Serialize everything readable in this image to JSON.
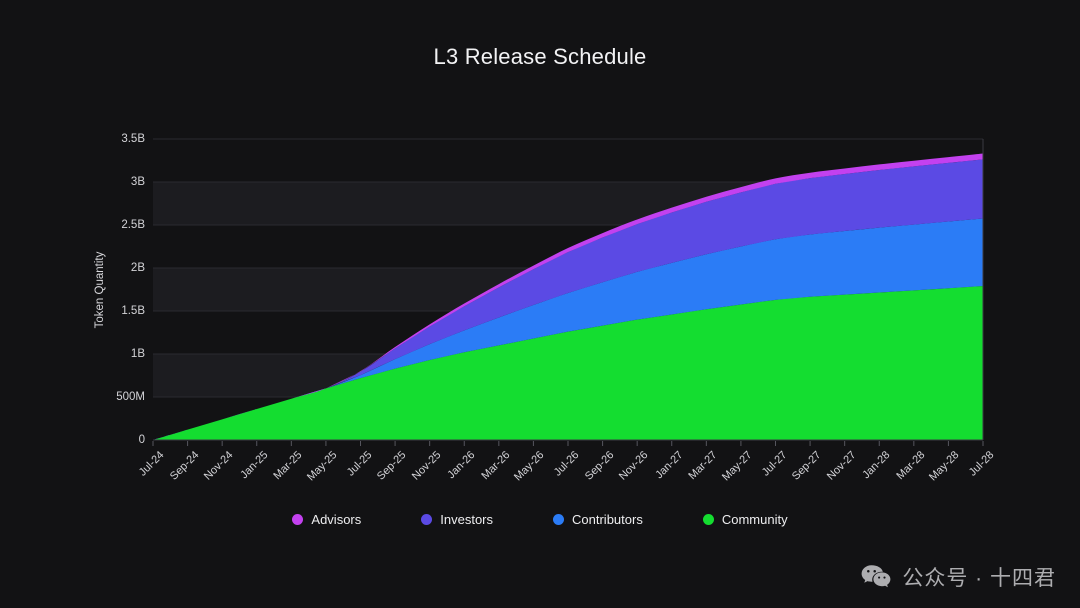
{
  "chart": {
    "title": "L3 Release Schedule",
    "y_axis_title": "Token Quantity"
  },
  "legend": {
    "items": [
      {
        "label": "Advisors",
        "color": "#c341ef"
      },
      {
        "label": "Investors",
        "color": "#5b4ae4"
      },
      {
        "label": "Contributors",
        "color": "#2b7cf6"
      },
      {
        "label": "Community",
        "color": "#14dd30"
      }
    ]
  },
  "watermark": {
    "icon": "wechat-icon",
    "text": "公众号 · 十四君"
  },
  "chart_data": {
    "type": "area",
    "stacked": true,
    "title": "L3 Release Schedule",
    "xlabel": "",
    "ylabel": "Token Quantity",
    "ylim": [
      0,
      3500000000
    ],
    "grid": true,
    "legend_position": "bottom",
    "y_ticks": [
      0,
      500000000,
      1000000000,
      1500000000,
      2000000000,
      2500000000,
      3000000000,
      3500000000
    ],
    "y_tick_labels": [
      "0",
      "500M",
      "1B",
      "1.5B",
      "2B",
      "2.5B",
      "3B",
      "3.5B"
    ],
    "categories": [
      "Jul-24",
      "Sep-24",
      "Nov-24",
      "Jan-25",
      "Mar-25",
      "May-25",
      "Jul-25",
      "Sep-25",
      "Nov-25",
      "Jan-26",
      "Mar-26",
      "May-26",
      "Jul-26",
      "Sep-26",
      "Nov-26",
      "Jan-27",
      "Mar-27",
      "May-27",
      "Jul-27",
      "Sep-27",
      "Nov-27",
      "Jan-28",
      "Mar-28",
      "May-28",
      "Jul-28"
    ],
    "series": [
      {
        "name": "Community",
        "color": "#14dd30",
        "values": [
          0,
          120000000,
          240000000,
          360000000,
          480000000,
          600000000,
          720000000,
          830000000,
          930000000,
          1020000000,
          1100000000,
          1180000000,
          1260000000,
          1330000000,
          1400000000,
          1460000000,
          1520000000,
          1575000000,
          1630000000,
          1665000000,
          1690000000,
          1715000000,
          1740000000,
          1765000000,
          1790000000
        ]
      },
      {
        "name": "Contributors",
        "color": "#2b7cf6",
        "values": [
          0,
          0,
          0,
          0,
          0,
          0,
          35000000,
          110000000,
          185000000,
          255000000,
          325000000,
          390000000,
          450000000,
          505000000,
          555000000,
          600000000,
          640000000,
          675000000,
          705000000,
          725000000,
          740000000,
          755000000,
          765000000,
          775000000,
          785000000
        ]
      },
      {
        "name": "Investors",
        "color": "#5b4ae4",
        "values": [
          0,
          0,
          0,
          0,
          0,
          0,
          40000000,
          125000000,
          205000000,
          280000000,
          350000000,
          415000000,
          475000000,
          520000000,
          555000000,
          585000000,
          610000000,
          630000000,
          645000000,
          655000000,
          663000000,
          670000000,
          676000000,
          682000000,
          688000000
        ]
      },
      {
        "name": "Advisors",
        "color": "#c341ef",
        "values": [
          0,
          0,
          0,
          0,
          0,
          0,
          6000000,
          16000000,
          25000000,
          32000000,
          38000000,
          43000000,
          47000000,
          51000000,
          54000000,
          57000000,
          59000000,
          61000000,
          62000000,
          63000000,
          64000000,
          65000000,
          66000000,
          67000000,
          68000000
        ]
      }
    ]
  }
}
